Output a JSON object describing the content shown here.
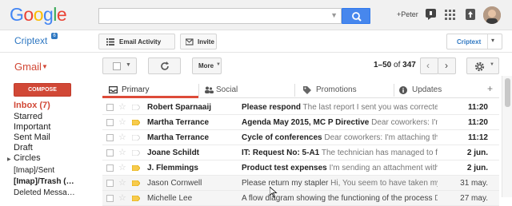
{
  "header": {
    "logo_letters": [
      "G",
      "o",
      "o",
      "g",
      "l",
      "e"
    ],
    "logo_colors": [
      "#4285f4",
      "#ea4335",
      "#fbbc05",
      "#4285f4",
      "#34a853",
      "#ea4335"
    ],
    "search_placeholder": "",
    "user_name": "+Peter"
  },
  "criptext": {
    "logo": "Criptext",
    "badge": "6",
    "email_activity_label": "Email Activity",
    "invite_label": "Invite",
    "dropdown_label": "Criptext"
  },
  "toolbar": {
    "gmail_label": "Gmail",
    "more_label": "More",
    "pager_range": "1–50",
    "pager_of": "of",
    "pager_total": "347"
  },
  "nav": {
    "compose_label": "COMPOSE",
    "items": [
      {
        "label": "Inbox  (7)"
      },
      {
        "label": "Starred"
      },
      {
        "label": "Important"
      },
      {
        "label": "Sent Mail"
      },
      {
        "label": "Draft"
      },
      {
        "label": "Circles"
      },
      {
        "label": "[Imap]/Sent"
      },
      {
        "label": "[Imap]/Trash (…"
      },
      {
        "label": "Deleted Messa…"
      }
    ]
  },
  "tabs": [
    {
      "label": "Primary",
      "icon": "inbox-icon"
    },
    {
      "label": "Social",
      "icon": "people-icon"
    },
    {
      "label": "Promotions",
      "icon": "tag-icon"
    },
    {
      "label": "Updates",
      "icon": "info-icon"
    }
  ],
  "emails": [
    {
      "sender": "Robert Sparnaaij",
      "subject": "Please respond",
      "snippet": "The last report I sent you was corrected",
      "date": "11:20",
      "unread": true,
      "important": false
    },
    {
      "sender": "Martha Terrance",
      "subject": "Agenda May 2015, MC P Directive",
      "snippet": "Dear coworkers: I'm",
      "date": "11:20",
      "unread": true,
      "important": true
    },
    {
      "sender": "Martha Terrance",
      "subject": "Cycle of conferences",
      "snippet": "Dear coworkers: I'm attaching the",
      "date": "11:12",
      "unread": true,
      "important": false
    },
    {
      "sender": "Joane Schildt",
      "subject": "IT: Request No: 5-A1",
      "snippet": "The technician has managed to fix",
      "date": "2 jun.",
      "unread": true,
      "important": false
    },
    {
      "sender": "J. Flemmings",
      "subject": "Product test expenses",
      "snippet": "I'm sending an attachment with",
      "date": "2 jun.",
      "unread": true,
      "important": true
    },
    {
      "sender": "Jason Cornwell",
      "subject": "Please return my stapler",
      "snippet": "Hi, You seem to have taken my",
      "date": "31 may.",
      "unread": false,
      "important": true
    },
    {
      "sender": "Michelle Lee",
      "subject": "A flow diagram showing the functioning of the process",
      "snippet": "Dear",
      "date": "27 may.",
      "unread": false,
      "important": true
    }
  ],
  "colors": {
    "accent": "#dd4b39",
    "search_button": "#4787ed",
    "criptext_blue": "#2f78c2",
    "important_marker": "#f7cb4d"
  }
}
